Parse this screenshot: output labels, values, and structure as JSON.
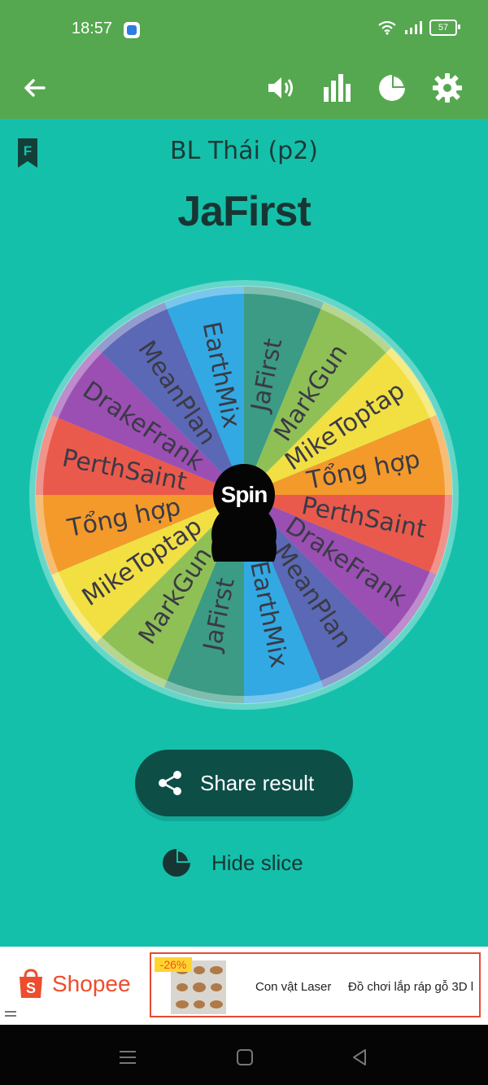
{
  "status": {
    "time": "18:57",
    "battery": "57",
    "icons": [
      "app-icon",
      "wifi-icon",
      "signal-icon",
      "battery-icon"
    ]
  },
  "toolbar": {
    "icons": [
      "back-arrow-icon",
      "volume-icon",
      "bar-chart-icon",
      "pie-chart-icon",
      "gear-icon"
    ]
  },
  "wheel": {
    "name": "BL Thái (p2)",
    "result": "JaFirst",
    "spin_label": "Spin",
    "slices": [
      {
        "label": "JaFirst",
        "color": "#3b9b84"
      },
      {
        "label": "MarkGun",
        "color": "#8fc056"
      },
      {
        "label": "MikeToptap",
        "color": "#f2e043"
      },
      {
        "label": "Tổng hợp",
        "color": "#f39a2b"
      },
      {
        "label": "PerthSaint",
        "color": "#ea5a4c"
      },
      {
        "label": "DrakeFrank",
        "color": "#9b4fb3"
      },
      {
        "label": "MeanPlan",
        "color": "#5b68b5"
      },
      {
        "label": "EarthMix",
        "color": "#32a9e3"
      },
      {
        "label": "JaFirst",
        "color": "#3b9b84"
      },
      {
        "label": "MarkGun",
        "color": "#8fc056"
      },
      {
        "label": "MikeToptap",
        "color": "#f2e043"
      },
      {
        "label": "Tổng hợp",
        "color": "#f39a2b"
      },
      {
        "label": "PerthSaint",
        "color": "#ea5a4c"
      },
      {
        "label": "DrakeFrank",
        "color": "#9b4fb3"
      },
      {
        "label": "MeanPlan",
        "color": "#5b68b5"
      },
      {
        "label": "EarthMix",
        "color": "#32a9e3"
      }
    ]
  },
  "actions": {
    "share_label": "Share result",
    "hide_label": "Hide slice"
  },
  "ad": {
    "brand": "Shopee",
    "discount": "-26%",
    "title": "Con vật Laser",
    "description": "Đồ chơi lắp ráp gỗ 3D l"
  }
}
